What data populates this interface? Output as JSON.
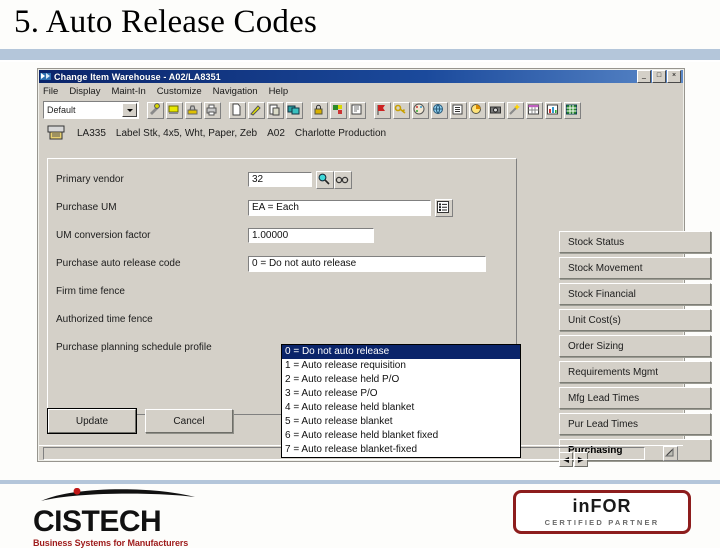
{
  "slide": {
    "title": "5. Auto Release Codes",
    "rule_color": "#b4c6da"
  },
  "window": {
    "title": "Change Item Warehouse - A02/LA8351",
    "icon": "app-icon",
    "controls": {
      "minimize": "_",
      "maximize": "□",
      "close": "×"
    },
    "menus": [
      {
        "label": "File",
        "mnemonic": "F"
      },
      {
        "label": "Display",
        "mnemonic": "D"
      },
      {
        "label": "Maint-In",
        "mnemonic": "M"
      },
      {
        "label": "Customize",
        "mnemonic": "C"
      },
      {
        "label": "Navigation",
        "mnemonic": "N"
      },
      {
        "label": "Help",
        "mnemonic": "H"
      }
    ],
    "toolbar": {
      "profile_value": "Default",
      "profile_placeholder": "Default",
      "buttons": [
        "tools-icon",
        "highlighter-icon",
        "stamp-icon",
        "printer-icon",
        "new-doc-icon",
        "edit-pencil-icon",
        "paste-icon",
        "copy-icon",
        "lock-icon",
        "puzzle-icon",
        "notes-icon",
        "flag-icon",
        "key-icon",
        "palette-icon",
        "globe-icon",
        "list-icon",
        "pie-icon",
        "camera-icon",
        "wand-icon",
        "grid-icon",
        "chart-icon",
        "table-icon"
      ]
    },
    "info_row": {
      "icon": "item-icon",
      "item": "LA335",
      "description": "Label Stk, 4x5, Wht, Paper, Zeb",
      "warehouse": "A02",
      "warehouse_name": "Charlotte Production"
    },
    "fields": [
      {
        "label": "Primary vendor",
        "value": "32",
        "type": "text",
        "buttons": [
          "search-icon",
          "glasses-icon"
        ]
      },
      {
        "label": "Purchase UM",
        "value": "EA = Each",
        "type": "combo",
        "buttons": [
          "detail-list-icon"
        ]
      },
      {
        "label": "UM conversion factor",
        "value": "1.00000",
        "type": "text",
        "buttons": []
      },
      {
        "label": "Purchase auto release code",
        "value": "0 = Do not auto release",
        "type": "combo-open",
        "buttons": []
      },
      {
        "label": "Firm time fence",
        "value": "",
        "type": "text",
        "buttons": []
      },
      {
        "label": "Authorized time fence",
        "value": "",
        "type": "text",
        "buttons": []
      },
      {
        "label": "Purchase planning schedule profile",
        "value": "",
        "type": "text",
        "buttons": []
      }
    ],
    "dropdown": {
      "selected_index": 0,
      "options": [
        "0 = Do not auto release",
        "1 = Auto release requisition",
        "2 = Auto release held P/O",
        "3 = Auto release P/O",
        "4 = Auto release held blanket",
        "5 = Auto release blanket",
        "6 = Auto release held blanket fixed",
        "7 = Auto release blanket-fixed"
      ]
    },
    "side_buttons": [
      {
        "label": "Stock Status",
        "active": false
      },
      {
        "label": "Stock Movement",
        "active": false
      },
      {
        "label": "Stock Financial",
        "active": false
      },
      {
        "label": "Unit Cost(s)",
        "active": false
      },
      {
        "label": "Order Sizing",
        "active": false
      },
      {
        "label": "Requirements Mgmt",
        "active": false
      },
      {
        "label": "Mfg Lead Times",
        "active": false
      },
      {
        "label": "Pur Lead Times",
        "active": false
      },
      {
        "label": "Purchasing",
        "active": true
      }
    ],
    "spinner": {
      "prev": "◀",
      "next": "▶"
    },
    "actions": [
      {
        "label": "Update",
        "default": true
      },
      {
        "label": "Cancel",
        "default": false
      }
    ]
  },
  "footer": {
    "cistech": {
      "name": "CISTECH",
      "tagline": "Business Systems for Manufacturers",
      "accent": "#9e1b1b"
    },
    "infor": {
      "name": "inFOR",
      "tagline": "CERTIFIED PARTNER",
      "border": "#8d1d1d"
    }
  }
}
